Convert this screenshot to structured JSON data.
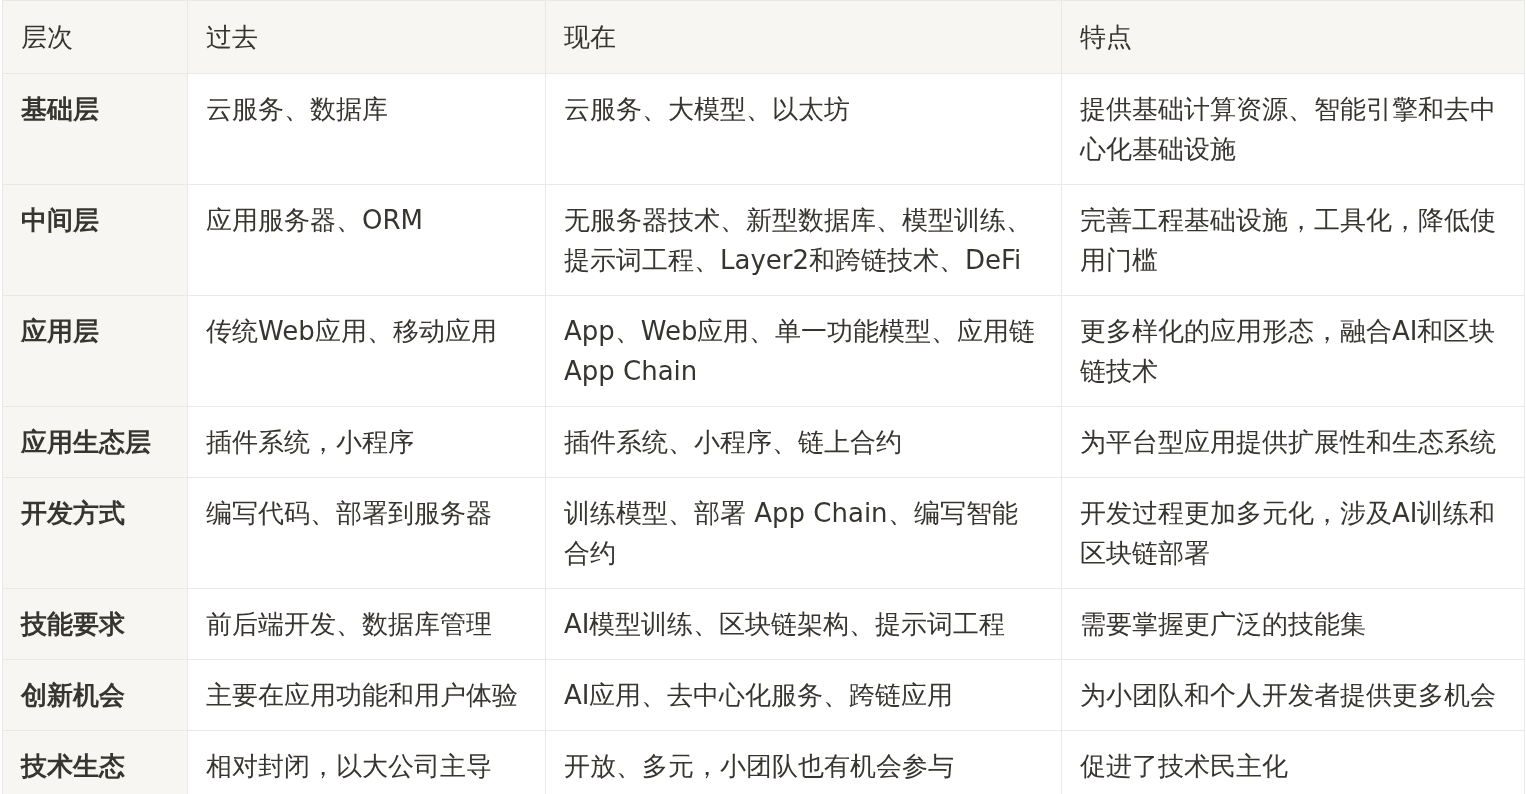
{
  "table": {
    "columns": [
      "层次",
      "过去",
      "现在",
      "特点"
    ],
    "rows": [
      {
        "cells": [
          "基础层",
          "云服务、数据库",
          "云服务、大模型、以太坊",
          "提供基础计算资源、智能引擎和去中心化基础设施"
        ]
      },
      {
        "cells": [
          "中间层",
          "应用服务器、ORM",
          "无服务器技术、新型数据库、模型训练、提示词工程、Layer2和跨链技术、DeFi",
          "完善工程基础设施，工具化，降低使用门槛"
        ]
      },
      {
        "cells": [
          "应用层",
          "传统Web应用、移动应用",
          "App、Web应用、单一功能模型、应用链 App Chain",
          "更多样化的应用形态，融合AI和区块链技术"
        ]
      },
      {
        "cells": [
          "应用生态层",
          "插件系统，小程序",
          "插件系统、小程序、链上合约",
          "为平台型应用提供扩展性和生态系统"
        ]
      },
      {
        "cells": [
          "开发方式",
          "编写代码、部署到服务器",
          "训练模型、部署 App Chain、编写智能合约",
          "开发过程更加多元化，涉及AI训练和区块链部署"
        ]
      },
      {
        "cells": [
          "技能要求",
          "前后端开发、数据库管理",
          "AI模型训练、区块链架构、提示词工程",
          "需要掌握更广泛的技能集"
        ]
      },
      {
        "cells": [
          "创新机会",
          "主要在应用功能和用户体验",
          "AI应用、去中心化服务、跨链应用",
          "为小团队和个人开发者提供更多机会"
        ]
      },
      {
        "cells": [
          "技术生态",
          "相对封闭，以大公司主导",
          "开放、多元，小团队也有机会参与",
          "促进了技术民主化"
        ]
      }
    ]
  }
}
